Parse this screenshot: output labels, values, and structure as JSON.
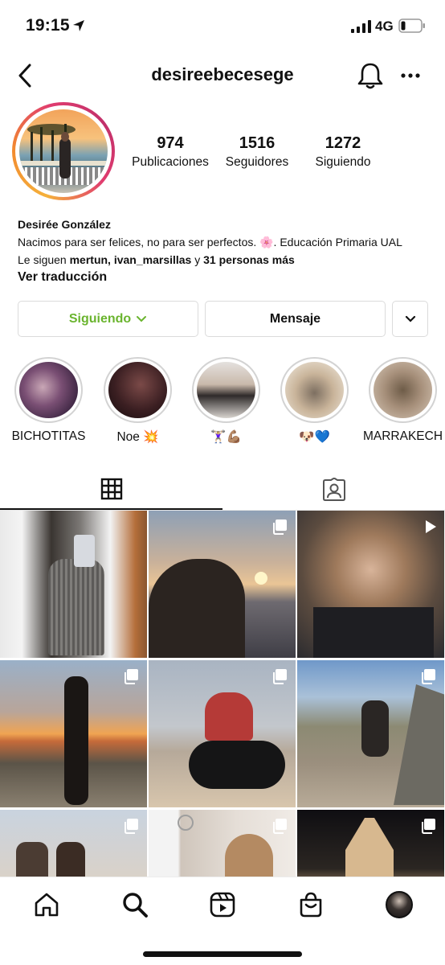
{
  "status_bar": {
    "time": "19:15",
    "network": "4G"
  },
  "header": {
    "username": "desireebecesege"
  },
  "profile": {
    "stats": [
      {
        "value": "974",
        "label": "Publicaciones"
      },
      {
        "value": "1516",
        "label": "Seguidores"
      },
      {
        "value": "1272",
        "label": "Siguiendo"
      }
    ],
    "name": "Desirée González",
    "bio": "Nacimos para ser felices, no para ser perfectos. 🌸. Educación Primaria UAL",
    "followed_by_prefix": "Le siguen ",
    "followed_by_users": "mertun, ivan_marsillas",
    "followed_by_mid": " y ",
    "followed_by_more": "31 personas más",
    "translate": "Ver traducción"
  },
  "actions": {
    "following": "Siguiendo",
    "message": "Mensaje"
  },
  "highlights": [
    {
      "label": "BICHOTITAS",
      "color": "#5a3a5c"
    },
    {
      "label": "Noe 💥",
      "color": "#3b1f22"
    },
    {
      "label": "🏋🏼‍♀️💪🏽",
      "color": "#8a7f78"
    },
    {
      "label": "🐶💙",
      "color": "#b9a58f"
    },
    {
      "label": "MARRAKECH",
      "color": "#a68f7a"
    }
  ],
  "accent_color": "#6ab42e",
  "icons": [
    "back-arrow-icon",
    "bell-icon",
    "more-options-icon",
    "chevron-down-icon",
    "grid-icon",
    "tagged-icon",
    "home-icon",
    "search-icon",
    "reels-icon",
    "shop-icon",
    "profile-avatar-icon",
    "multiple-posts-icon"
  ]
}
